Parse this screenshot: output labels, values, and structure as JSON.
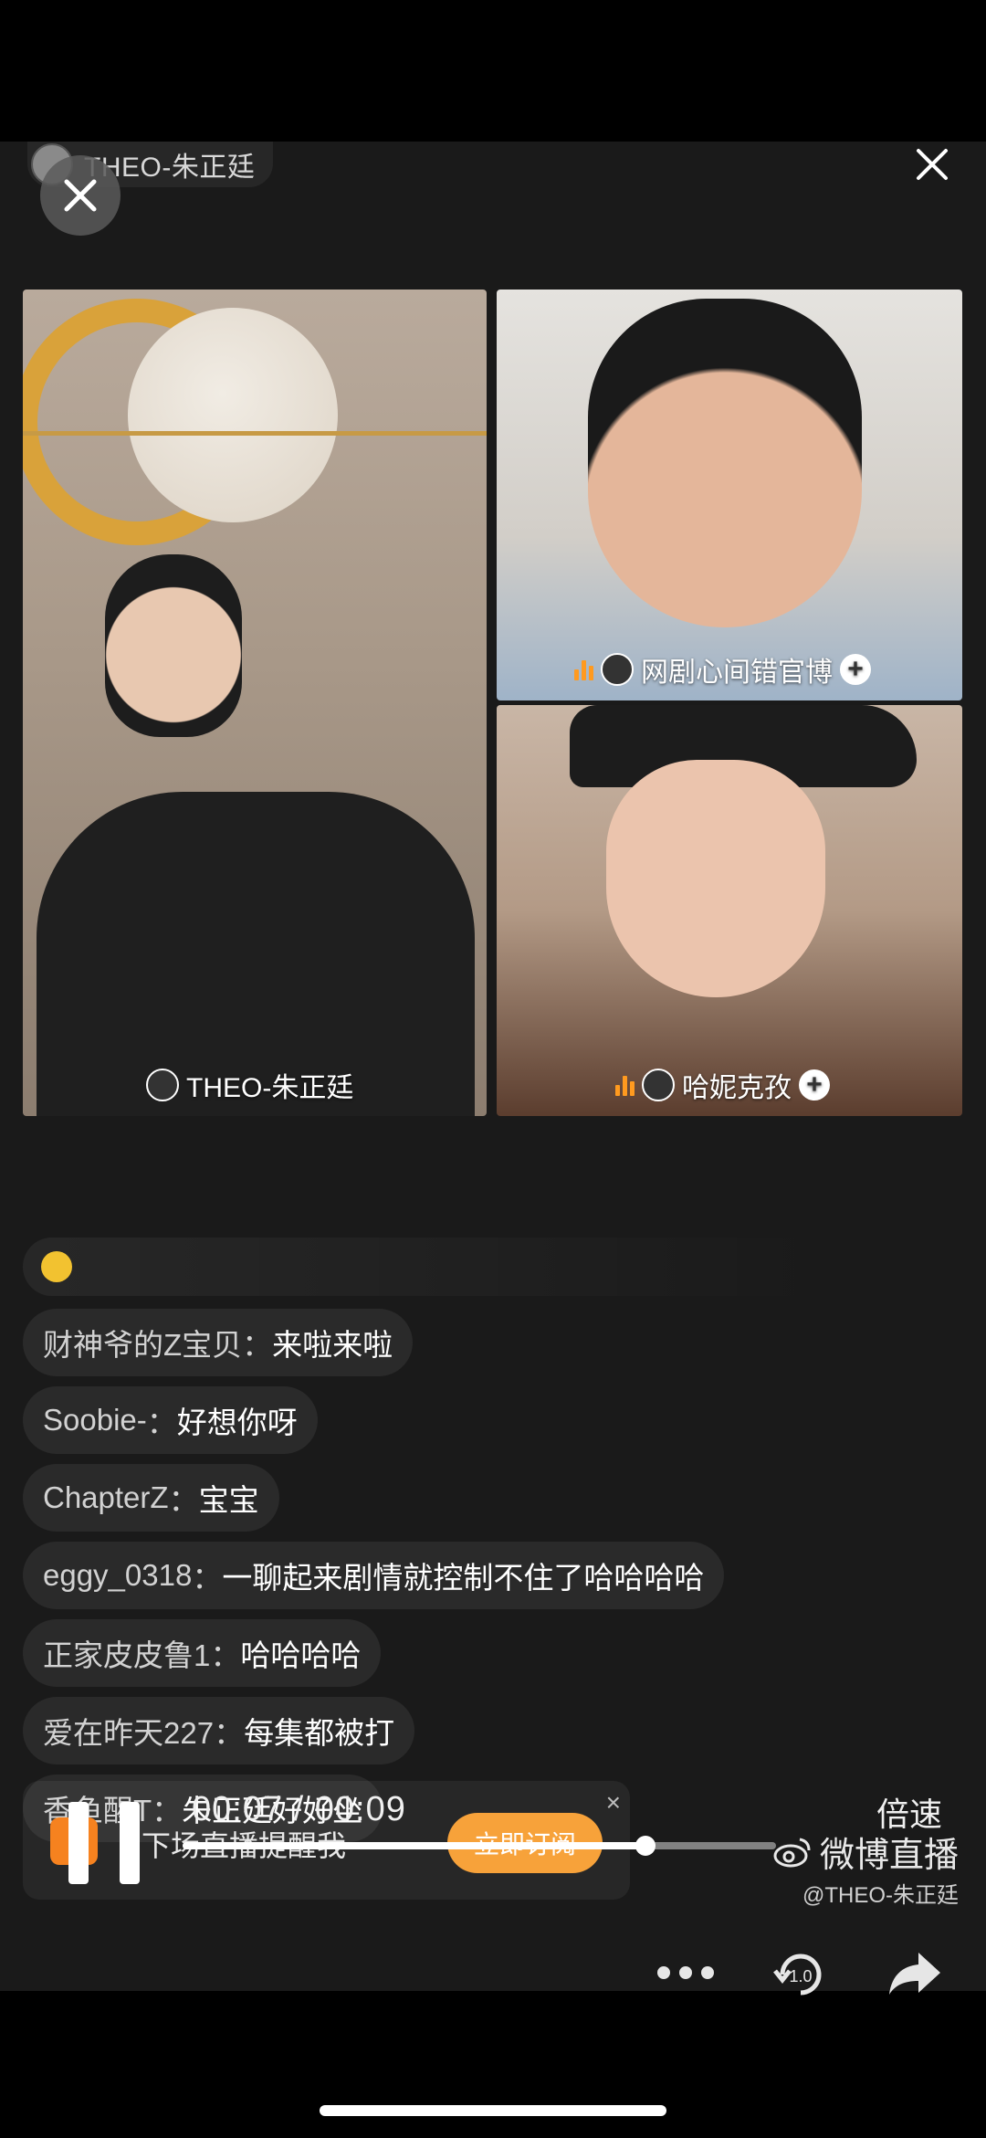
{
  "header": {
    "host_name": "THEO-朱正廷",
    "close_icon": "close-icon"
  },
  "overlay": {
    "close_icon": "close-icon"
  },
  "panes": [
    {
      "label": "THEO-朱正廷",
      "speaking": false
    },
    {
      "label": "网剧心间错官博",
      "speaking": true
    },
    {
      "label": "哈妮克孜",
      "speaking": true
    }
  ],
  "comments": [
    {
      "user": "财神爷的Z宝贝",
      "text": "来啦来啦"
    },
    {
      "user": "Soobie-",
      "text": "好想你呀"
    },
    {
      "user": "ChapterZ",
      "text": "宝宝"
    },
    {
      "user": "eggy_0318",
      "text": "一聊起来剧情就控制不住了哈哈哈哈"
    },
    {
      "user": "正家皮皮鲁1",
      "text": "哈哈哈哈"
    },
    {
      "user": "爱在昨天227",
      "text": "每集都被打"
    },
    {
      "user": "香鱼醒T",
      "text": "朱正廷好好坐"
    }
  ],
  "comment_sep": "：",
  "reminder": {
    "text": "下场直播提醒我",
    "button": "立即订阅",
    "close": "×"
  },
  "watermark": {
    "brand": "微博直播",
    "handle": "@THEO-朱正廷"
  },
  "player": {
    "current_time": "00:07",
    "separator": "/",
    "duration": "00:09",
    "speed_label": "倍速",
    "progress": 0.78,
    "rotate_label": "1.0"
  },
  "colors": {
    "accent_orange": "#f7a23a",
    "background": "#1a1a1a"
  }
}
